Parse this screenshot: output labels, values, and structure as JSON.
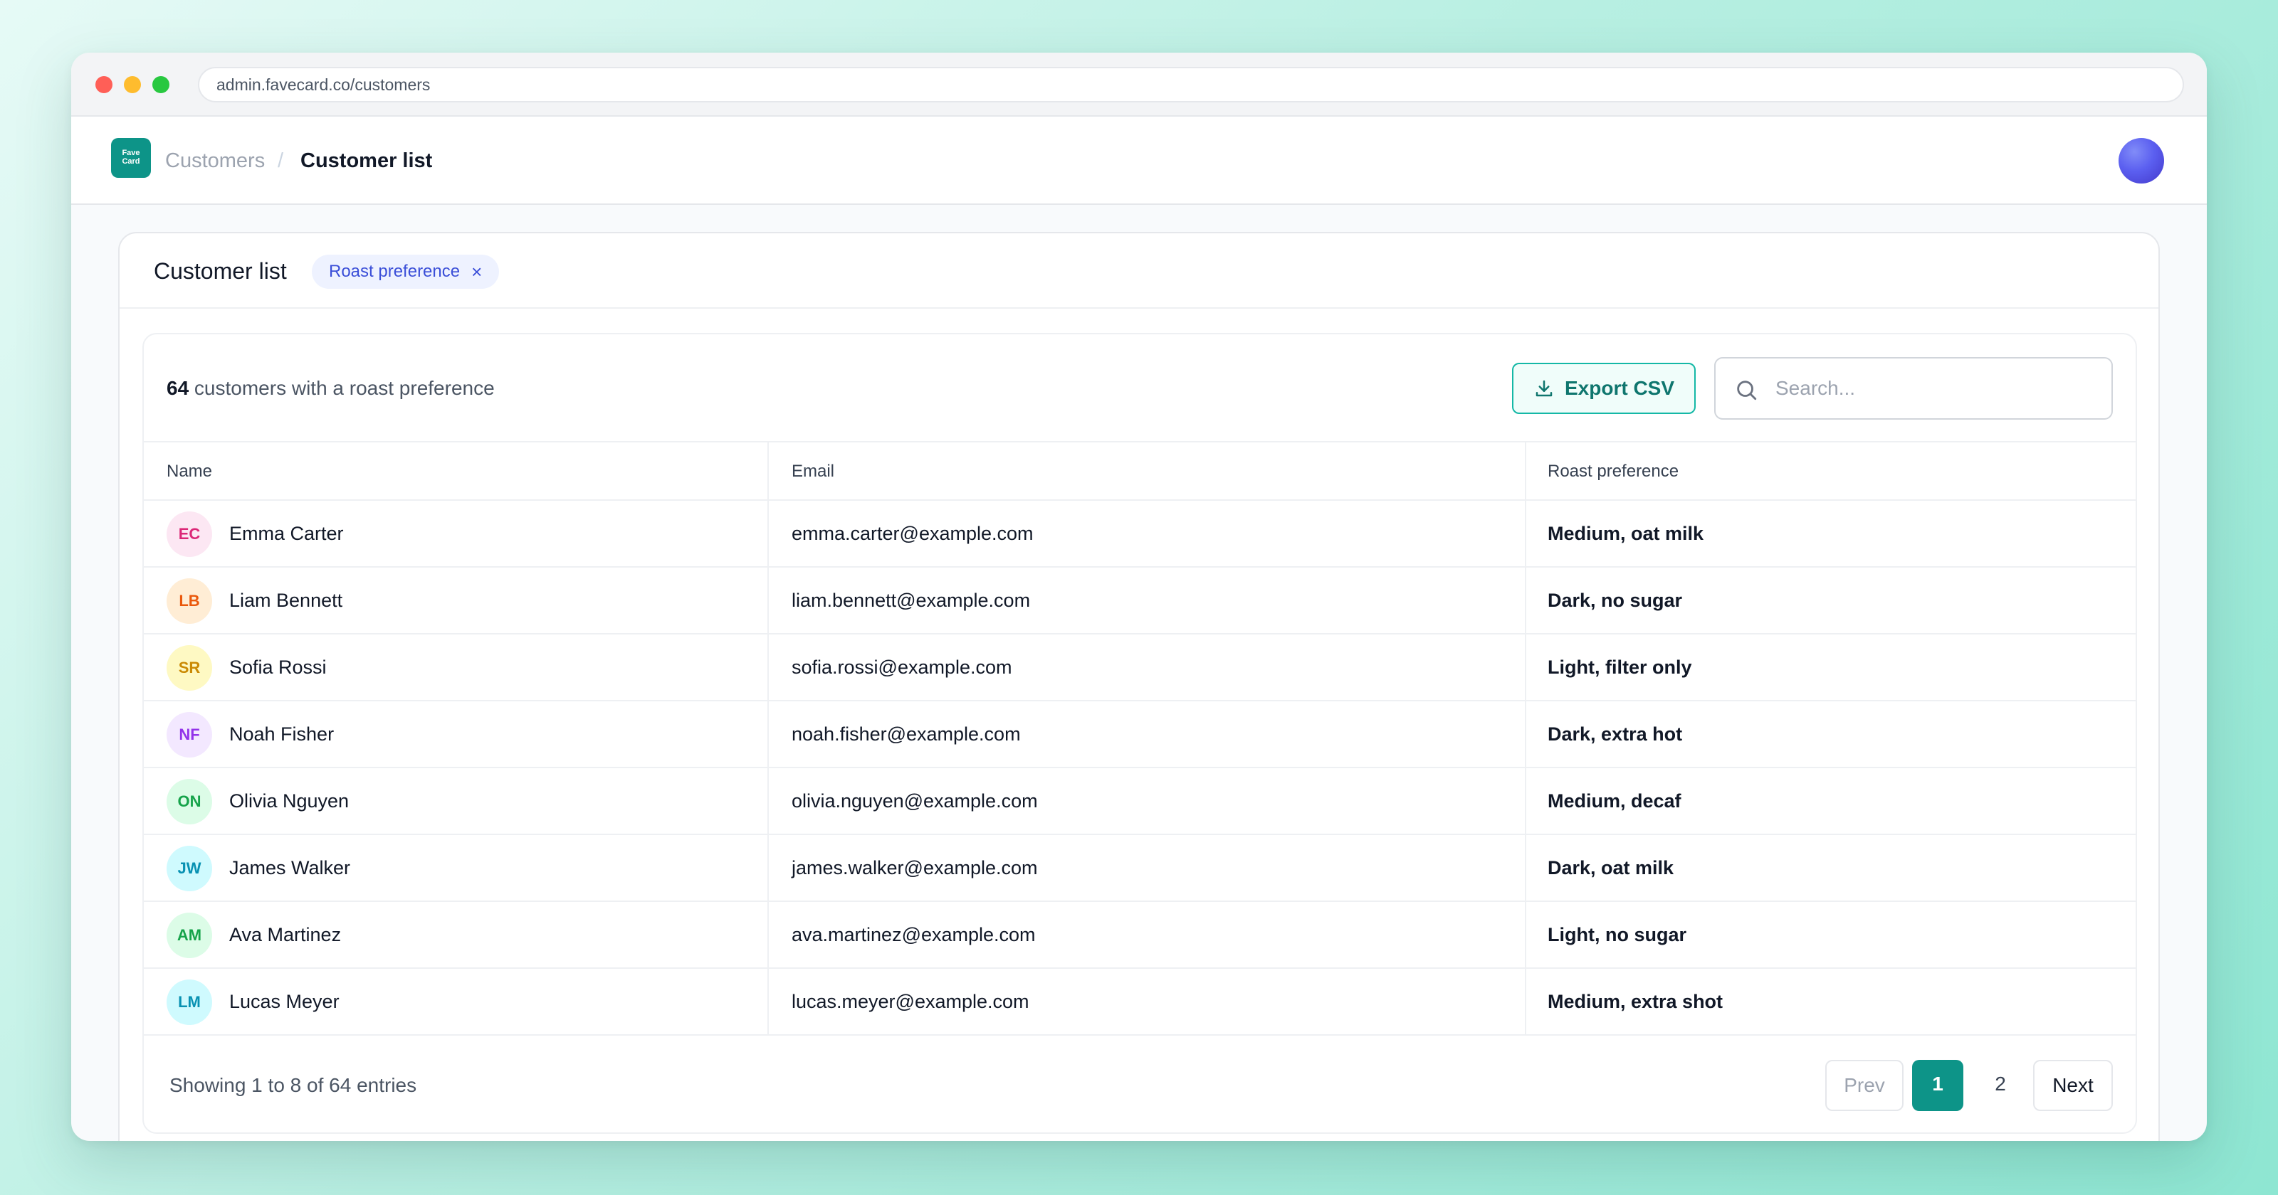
{
  "browser": {
    "url": "admin.favecard.co/customers"
  },
  "header": {
    "logo_text": "Fave Card",
    "breadcrumb": [
      "Customers",
      "Customer list"
    ],
    "separator": "/"
  },
  "card": {
    "title": "Customer list",
    "filter_chip": "Roast preference",
    "chip_close": "×"
  },
  "toolbar": {
    "count": "64",
    "count_suffix": " customers with a roast preference",
    "export_label": "Export CSV",
    "search_placeholder": "Search..."
  },
  "table": {
    "columns": [
      "Name",
      "Email",
      "Roast preference"
    ],
    "rows": [
      {
        "initials": "EC",
        "name": "Emma Carter",
        "email": "emma.carter@example.com",
        "pref": "Medium, oat milk",
        "avatar_bg": "#fce7f3",
        "avatar_fg": "#db2777"
      },
      {
        "initials": "LB",
        "name": "Liam Bennett",
        "email": "liam.bennett@example.com",
        "pref": "Dark, no sugar",
        "avatar_bg": "#ffedd5",
        "avatar_fg": "#ea580c"
      },
      {
        "initials": "SR",
        "name": "Sofia Rossi",
        "email": "sofia.rossi@example.com",
        "pref": "Light, filter only",
        "avatar_bg": "#fef9c3",
        "avatar_fg": "#ca8a04"
      },
      {
        "initials": "NF",
        "name": "Noah Fisher",
        "email": "noah.fisher@example.com",
        "pref": "Dark, extra hot",
        "avatar_bg": "#f3e8ff",
        "avatar_fg": "#9333ea"
      },
      {
        "initials": "ON",
        "name": "Olivia Nguyen",
        "email": "olivia.nguyen@example.com",
        "pref": "Medium, decaf",
        "avatar_bg": "#dcfce7",
        "avatar_fg": "#16a34a"
      },
      {
        "initials": "JW",
        "name": "James Walker",
        "email": "james.walker@example.com",
        "pref": "Dark, oat milk",
        "avatar_bg": "#cffafe",
        "avatar_fg": "#0891b2"
      },
      {
        "initials": "AM",
        "name": "Ava Martinez",
        "email": "ava.martinez@example.com",
        "pref": "Light, no sugar",
        "avatar_bg": "#dcfce7",
        "avatar_fg": "#16a34a"
      },
      {
        "initials": "LM",
        "name": "Lucas Meyer",
        "email": "lucas.meyer@example.com",
        "pref": "Medium, extra shot",
        "avatar_bg": "#cffafe",
        "avatar_fg": "#0891b2"
      }
    ]
  },
  "pagination": {
    "showing": "Showing 1 to 8 of 64 entries",
    "prev": "Prev",
    "pages": [
      "1",
      "2"
    ],
    "current": "1",
    "next": "Next"
  },
  "colors": {
    "accent": "#0d9488",
    "chip_bg": "#eef2ff",
    "chip_text": "#3b4fd8"
  },
  "icons": {
    "export": "download-icon",
    "search": "search-icon",
    "chip_close": "close-icon",
    "user": "avatar"
  }
}
